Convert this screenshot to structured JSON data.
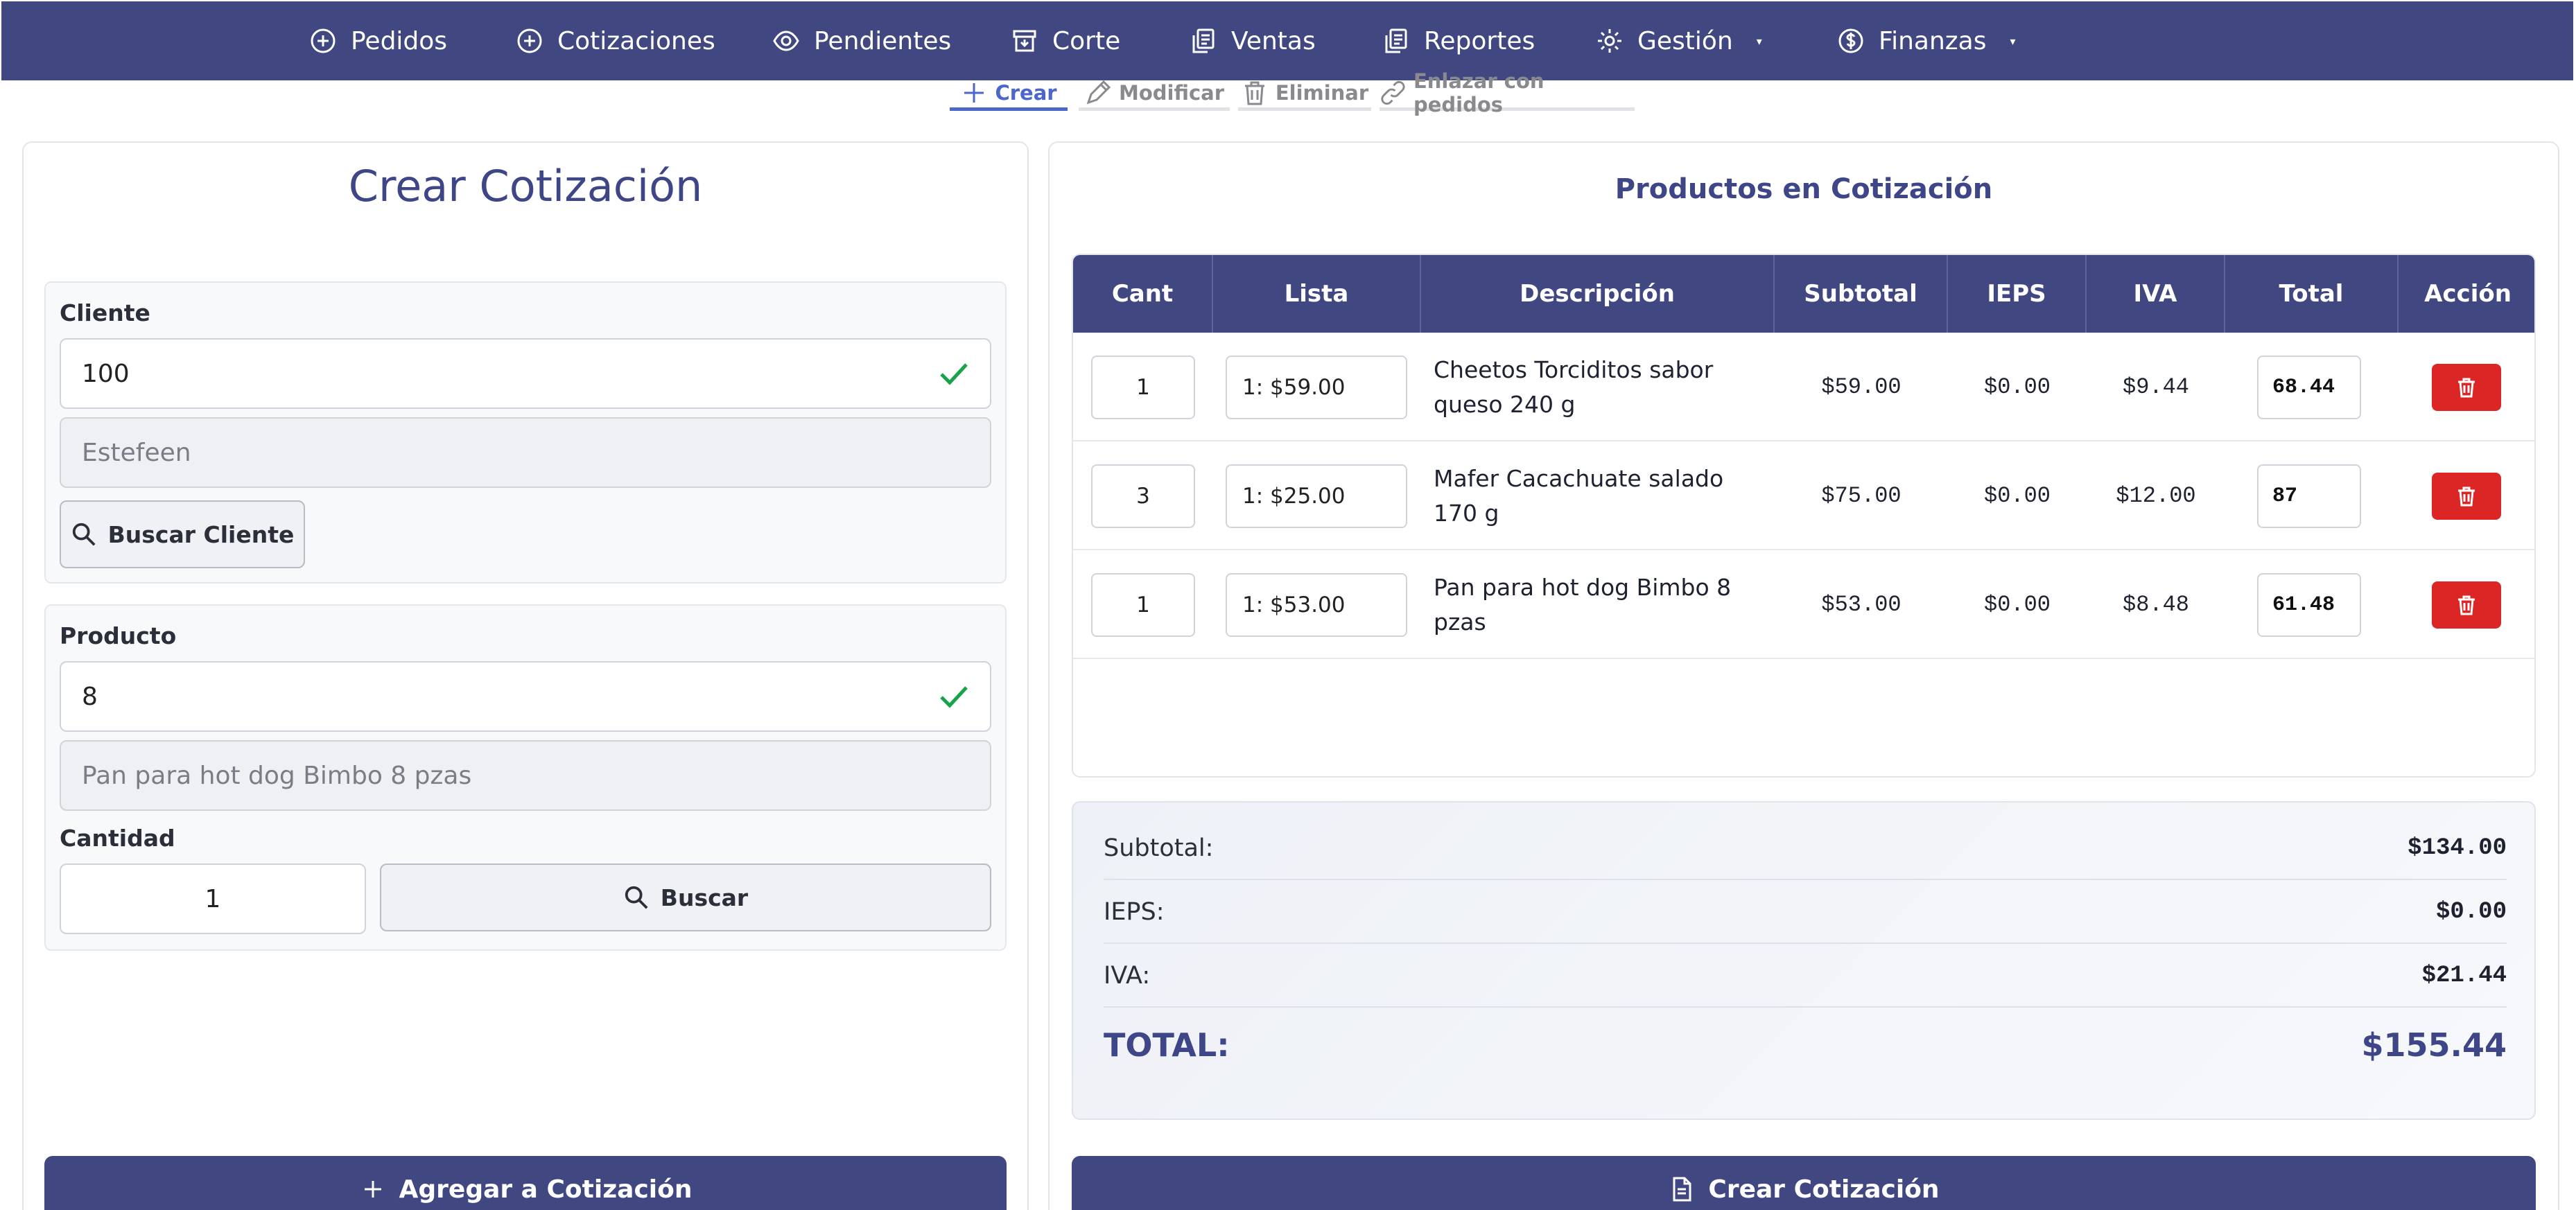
{
  "nav": {
    "items": [
      {
        "label": "Pedidos",
        "icon": "plus-circle-icon"
      },
      {
        "label": "Cotizaciones",
        "icon": "plus-circle-icon"
      },
      {
        "label": "Pendientes",
        "icon": "eye-icon"
      },
      {
        "label": "Corte",
        "icon": "archive-icon"
      },
      {
        "label": "Ventas",
        "icon": "documents-icon"
      },
      {
        "label": "Reportes",
        "icon": "documents-icon"
      },
      {
        "label": "Gestión",
        "icon": "gear-icon",
        "caret": "▾"
      },
      {
        "label": "Finanzas",
        "icon": "dollar-circle-icon",
        "caret": "▾"
      }
    ]
  },
  "subtabs": [
    {
      "label": "Crear",
      "icon": "plus-icon",
      "active": true
    },
    {
      "label": "Modificar",
      "icon": "pencil-icon",
      "active": false
    },
    {
      "label": "Eliminar",
      "icon": "trash-icon",
      "active": false
    },
    {
      "label": "Enlazar con pedidos",
      "icon": "link-icon",
      "active": false
    }
  ],
  "left": {
    "title": "Crear Cotización",
    "cliente_label": "Cliente",
    "cliente_id": "100",
    "cliente_name": "Estefeen",
    "buscar_cliente": "Buscar Cliente",
    "producto_label": "Producto",
    "producto_id": "8",
    "producto_name": "Pan para hot dog Bimbo 8 pzas",
    "cantidad_label": "Cantidad",
    "cantidad": "1",
    "buscar": "Buscar",
    "agregar": "Agregar a Cotización"
  },
  "right": {
    "title": "Productos en Cotización",
    "headers": [
      "Cant",
      "Lista",
      "Descripción",
      "Subtotal",
      "IEPS",
      "IVA",
      "Total",
      "Acción"
    ],
    "rows": [
      {
        "cant": "1",
        "lista": "1: $59.00",
        "desc": "Cheetos Torciditos sabor queso 240 g",
        "subtotal": "$59.00",
        "ieps": "$0.00",
        "iva": "$9.44",
        "total": "68.44"
      },
      {
        "cant": "3",
        "lista": "1: $25.00",
        "desc": "Mafer Cacachuate salado 170 g",
        "subtotal": "$75.00",
        "ieps": "$0.00",
        "iva": "$12.00",
        "total": "87"
      },
      {
        "cant": "1",
        "lista": "1: $53.00",
        "desc": "Pan para hot dog Bimbo 8 pzas",
        "subtotal": "$53.00",
        "ieps": "$0.00",
        "iva": "$8.48",
        "total": "61.48"
      }
    ],
    "summary": {
      "subtotal_label": "Subtotal:",
      "subtotal": "$134.00",
      "ieps_label": "IEPS:",
      "ieps": "$0.00",
      "iva_label": "IVA:",
      "iva": "$21.44",
      "total_label": "TOTAL:",
      "total": "$155.44"
    },
    "crear": "Crear Cotización"
  },
  "colors": {
    "primary": "#404781",
    "accent": "#4a67c9",
    "danger": "#dc2626",
    "success": "#16a34a"
  }
}
